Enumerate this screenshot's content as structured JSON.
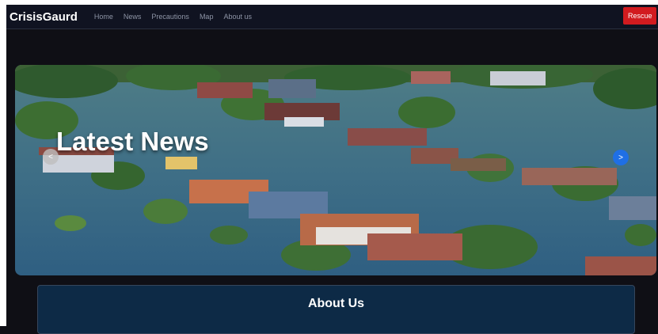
{
  "navbar": {
    "brand": "CrisisGaurd",
    "links": [
      "Home",
      "News",
      "Precautions",
      "Map",
      "About us"
    ],
    "rescue_label": "Rescue"
  },
  "hero": {
    "title": "Latest News",
    "prev_glyph": "<",
    "next_glyph": ">"
  },
  "about": {
    "title": "About Us"
  },
  "colors": {
    "navbar_bg": "#101321",
    "rescue_bg": "#d21b1f",
    "about_bg": "#0d2a46",
    "next_arrow": "#1f6fe5"
  },
  "icons": [
    "chevron-left-icon",
    "chevron-right-icon"
  ]
}
